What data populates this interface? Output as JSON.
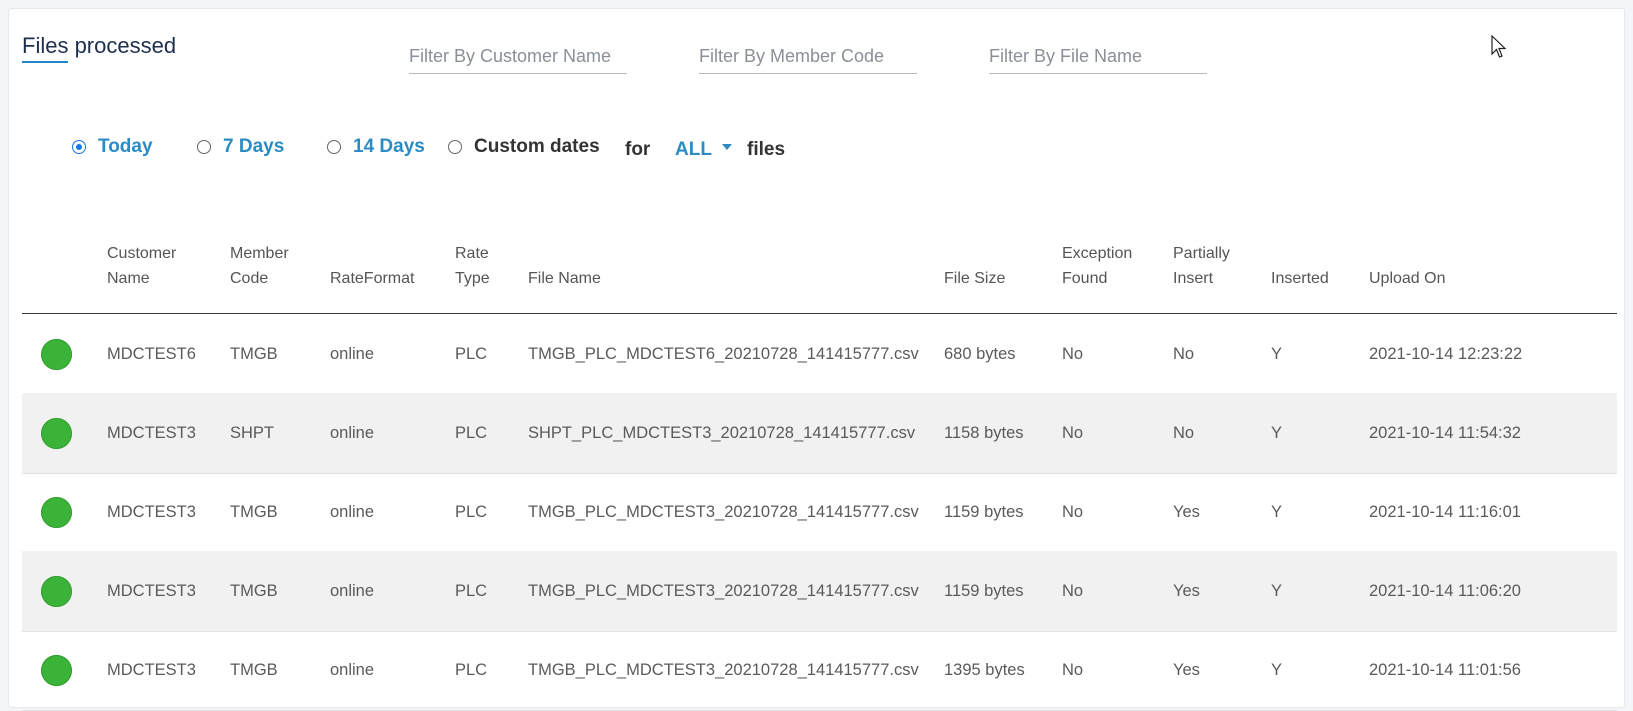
{
  "header": {
    "title_part1": "Files",
    "title_part2": " processed"
  },
  "filters": {
    "customer_placeholder": "Filter By Customer Name",
    "member_placeholder": "Filter By Member Code",
    "file_placeholder": "Filter By File Name"
  },
  "range": {
    "options": [
      {
        "label": "Today",
        "checked": true
      },
      {
        "label": "7 Days",
        "checked": false
      },
      {
        "label": "14 Days",
        "checked": false
      },
      {
        "label": "Custom dates",
        "checked": false
      }
    ],
    "for_text": "for",
    "scope_value": "ALL",
    "files_text": "files"
  },
  "table": {
    "headers": {
      "customer_name": [
        "Customer",
        "Name"
      ],
      "member_code": [
        "Member",
        "Code"
      ],
      "rate_format": [
        "RateFormat"
      ],
      "rate_type": [
        "Rate",
        "Type"
      ],
      "file_name": [
        "File Name"
      ],
      "file_size": [
        "File Size"
      ],
      "exception_found": [
        "Exception",
        "Found"
      ],
      "partially_insert": [
        "Partially",
        "Insert"
      ],
      "inserted": [
        "Inserted"
      ],
      "upload_on": [
        "Upload On"
      ]
    },
    "rows": [
      {
        "status": "success",
        "customer": "MDCTEST6",
        "member": "TMGB",
        "format": "online",
        "type": "PLC",
        "file": "TMGB_PLC_MDCTEST6_20210728_141415777.csv",
        "size": "680 bytes",
        "exception": "No",
        "partial": "No",
        "inserted": "Y",
        "upload": "2021-10-14 12:23:22"
      },
      {
        "status": "success",
        "customer": "MDCTEST3",
        "member": "SHPT",
        "format": "online",
        "type": "PLC",
        "file": "SHPT_PLC_MDCTEST3_20210728_141415777.csv",
        "size": "1158 bytes",
        "exception": "No",
        "partial": "No",
        "inserted": "Y",
        "upload": "2021-10-14 11:54:32"
      },
      {
        "status": "success",
        "customer": "MDCTEST3",
        "member": "TMGB",
        "format": "online",
        "type": "PLC",
        "file": "TMGB_PLC_MDCTEST3_20210728_141415777.csv",
        "size": "1159 bytes",
        "exception": "No",
        "partial": "Yes",
        "inserted": "Y",
        "upload": "2021-10-14 11:16:01"
      },
      {
        "status": "success",
        "customer": "MDCTEST3",
        "member": "TMGB",
        "format": "online",
        "type": "PLC",
        "file": "TMGB_PLC_MDCTEST3_20210728_141415777.csv",
        "size": "1159 bytes",
        "exception": "No",
        "partial": "Yes",
        "inserted": "Y",
        "upload": "2021-10-14 11:06:20"
      },
      {
        "status": "success",
        "customer": "MDCTEST3",
        "member": "TMGB",
        "format": "online",
        "type": "PLC",
        "file": "TMGB_PLC_MDCTEST3_20210728_141415777.csv",
        "size": "1395 bytes",
        "exception": "No",
        "partial": "Yes",
        "inserted": "Y",
        "upload": "2021-10-14 11:01:56"
      }
    ]
  },
  "colors": {
    "accent": "#2b8cc4",
    "status_success": "#3bb339"
  }
}
